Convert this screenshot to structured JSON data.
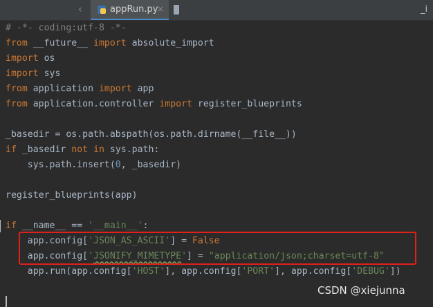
{
  "tabs": [
    {
      "label": "appRun.py",
      "close": "×",
      "icon": "python-file-icon"
    },
    {
      "label": "_i",
      "icon": "file-icon"
    }
  ],
  "scroll_left_glyph": "‹",
  "code": {
    "l1": "# -*- coding:utf-8 -*-",
    "l2_kw1": "from",
    "l2_mod": " __future__ ",
    "l2_kw2": "import",
    "l2_name": " absolute_import",
    "l3_kw": "import",
    "l3_mod": " os",
    "l4_kw": "import",
    "l4_mod": " sys",
    "l5_kw1": "from",
    "l5_mod": " application ",
    "l5_kw2": "import",
    "l5_name": " app",
    "l6_kw1": "from",
    "l6_mod": " application.controller ",
    "l6_kw2": "import",
    "l6_name": " register_blueprints",
    "l8": "_basedir = os.path.abspath(os.path.dirname(__file__))",
    "l9_kw1": "if",
    "l9_a": " _basedir ",
    "l9_kw2": "not in",
    "l9_b": " sys.path:",
    "l10_a": "    sys.path.insert(",
    "l10_num": "0",
    "l10_b": ", _basedir)",
    "l12": "register_blueprints(app)",
    "l14_kw": "if",
    "l14_a": " __name__ == ",
    "l14_str": "'__main__'",
    "l14_b": ":",
    "l15_a": "    app.config[",
    "l15_str": "'JSON_AS_ASCII'",
    "l15_b": "] = ",
    "l15_kw": "False",
    "l16_a": "    app.config[",
    "l16_str1": "'",
    "l16_ul": "JSONIFY_MIMETYPE",
    "l16_str2": "'",
    "l16_b": "] = ",
    "l16_str3": "\"application/json;charset=utf-8\"",
    "l17_a": "    app.run(app.config[",
    "l17_s1": "'HOST'",
    "l17_b": "], app.config[",
    "l17_s2": "'PORT'",
    "l17_c": "], app.config[",
    "l17_s3": "'DEBUG'",
    "l17_d": "])"
  },
  "watermark": "CSDN @xiejunna",
  "colors": {
    "highlight": "#e0201b",
    "keyword": "#cc7832",
    "string": "#6a8759",
    "comment": "#808080",
    "number": "#6897bb"
  }
}
